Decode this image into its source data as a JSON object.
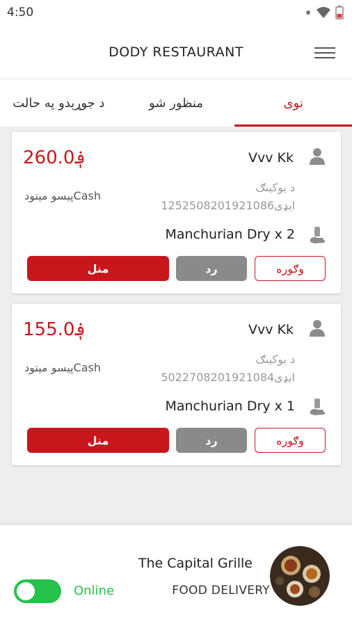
{
  "status_bar": {
    "time": "4:50"
  },
  "header": {
    "title": "DODY RESTAURANT"
  },
  "tabs": [
    {
      "label": "نوی",
      "active": true
    },
    {
      "label": "منظور شو",
      "active": false
    },
    {
      "label": "د جوړېدو په حالت",
      "active": false
    }
  ],
  "orders": [
    {
      "price": "260.0؋",
      "customer": "Vvv Kk",
      "payment": "پیسو میتودCash",
      "booking_label": "د بوکینګ",
      "booking_id": "1252508201921086ایډی",
      "item": "Manchurian Dry x 2",
      "accept_label": "منل",
      "reject_label": "رد",
      "view_label": "وګوره"
    },
    {
      "price": "155.0؋",
      "customer": "Vvv Kk",
      "payment": "پیسو میتودCash",
      "booking_label": "د بوکینګ",
      "booking_id": "5022708201921084ایډی",
      "item": "Manchurian Dry x 1",
      "accept_label": "منل",
      "reject_label": "رد",
      "view_label": "وګوره"
    }
  ],
  "footer": {
    "online_label": "Online",
    "online": true,
    "restaurant_name": "The Capital Grille",
    "restaurant_subtitle": "FOOD DELIVERY"
  },
  "colors": {
    "accent": "#c8161d",
    "online": "#27c24c",
    "reject": "#8a8a8a"
  }
}
